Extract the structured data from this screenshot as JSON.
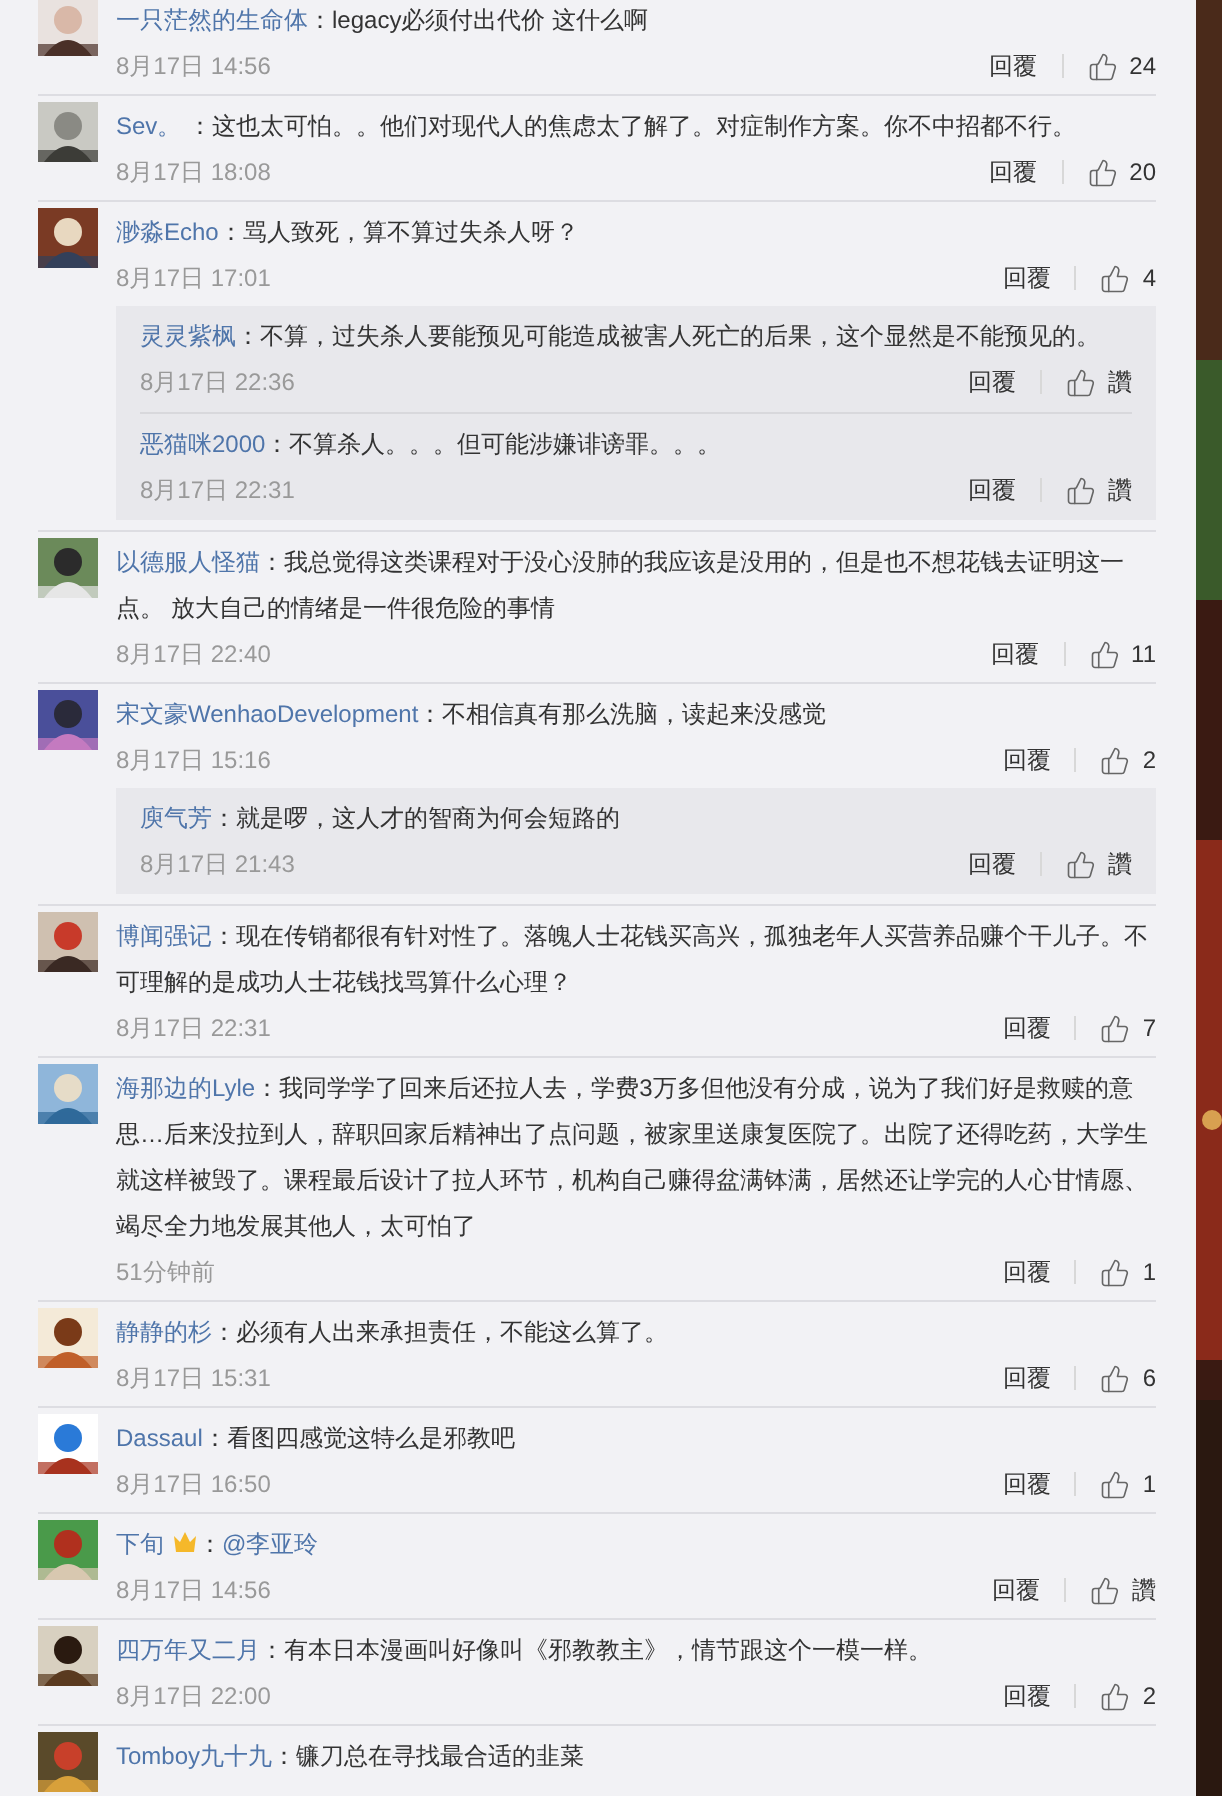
{
  "comments": [
    {
      "user": "一只茫然的生命体",
      "text": "：legacy必须付出代价 这什么啊",
      "time": "8月17日 14:56",
      "reply": "回覆",
      "likes": "24"
    },
    {
      "user": "Sev。",
      "text": " ：这也太可怕。。他们对现代人的焦虑太了解了。对症制作方案。你不中招都不行。",
      "time": "8月17日 18:08",
      "reply": "回覆",
      "likes": "20"
    },
    {
      "user": "渺淼Echo",
      "text": "：骂人致死，算不算过失杀人呀？",
      "time": "8月17日 17:01",
      "reply": "回覆",
      "likes": "4",
      "replies": [
        {
          "user": "灵灵紫枫",
          "text": "：不算，过失杀人要能预见可能造成被害人死亡的后果，这个显然是不能预见的。",
          "time": "8月17日 22:36",
          "reply": "回覆",
          "likes": "讚"
        },
        {
          "user": "恶猫咪2000",
          "text": "：不算杀人。。。但可能涉嫌诽谤罪。。。",
          "time": "8月17日 22:31",
          "reply": "回覆",
          "likes": "讚"
        }
      ]
    },
    {
      "user": "以德服人怪猫",
      "text": "：我总觉得这类课程对于没心没肺的我应该是没用的，但是也不想花钱去证明这一点。 放大自己的情绪是一件很危险的事情",
      "time": "8月17日 22:40",
      "reply": "回覆",
      "likes": "11"
    },
    {
      "user": "宋文豪WenhaoDevelopment",
      "text": "：不相信真有那么洗脑，读起来没感觉",
      "time": "8月17日 15:16",
      "reply": "回覆",
      "likes": "2",
      "replies": [
        {
          "user": "庾气芳",
          "text": "：就是啰，这人才的智商为何会短路的",
          "time": "8月17日 21:43",
          "reply": "回覆",
          "likes": "讚"
        }
      ]
    },
    {
      "user": "博闻强记",
      "text": "：现在传销都很有针对性了。落魄人士花钱买高兴，孤独老年人买营养品赚个干儿子。不可理解的是成功人士花钱找骂算什么心理？",
      "time": "8月17日 22:31",
      "reply": "回覆",
      "likes": "7"
    },
    {
      "user": "海那边的Lyle",
      "text": "：我同学学了回来后还拉人去，学费3万多但他没有分成，说为了我们好是救赎的意思…后来没拉到人，辞职回家后精神出了点问题，被家里送康复医院了。出院了还得吃药，大学生就这样被毁了。课程最后设计了拉人环节，机构自己赚得盆满钵满，居然还让学完的人心甘情愿、竭尽全力地发展其他人，太可怕了",
      "time": "51分钟前",
      "reply": "回覆",
      "likes": "1"
    },
    {
      "user": "静静的杉",
      "text": "：必须有人出来承担责任，不能这么算了。",
      "time": "8月17日 15:31",
      "reply": "回覆",
      "likes": "6"
    },
    {
      "user": "Dassaul",
      "text": "：看图四感觉这特么是邪教吧",
      "time": "8月17日 16:50",
      "reply": "回覆",
      "likes": "1"
    },
    {
      "user": "下旬",
      "vip": true,
      "mention": "@李亚玲",
      "text": "：",
      "time": "8月17日 14:56",
      "reply": "回覆",
      "likes": "讚"
    },
    {
      "user": "四万年又二月",
      "text": "：有本日本漫画叫好像叫《邪教教主》，情节跟这个一模一样。",
      "time": "8月17日 22:00",
      "reply": "回覆",
      "likes": "2"
    },
    {
      "user": "Tomboy九十九",
      "text": "：镰刀总在寻找最合适的韭菜"
    }
  ]
}
